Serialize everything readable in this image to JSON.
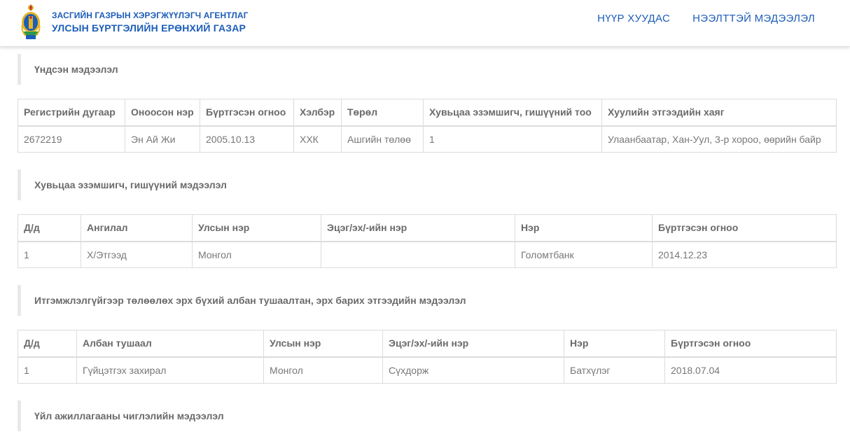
{
  "header": {
    "agency": "ЗАСГИЙН ГАЗРЫН ХЭРЭГЖҮҮЛЭГЧ АГЕНТЛАГ",
    "org": "УЛСЫН БҮРТГЭЛИЙН ЕРӨНХИЙ ГАЗАР",
    "nav": [
      "НҮҮР ХУУДАС",
      "НЭЭЛТТЭЙ МЭДЭЭЛЭЛ"
    ]
  },
  "basic": {
    "title": "Үндсэн мэдээлэл",
    "headers": [
      "Регистрийн дугаар",
      "Оноосон нэр",
      "Бүртгэсэн огноо",
      "Хэлбэр",
      "Төрөл",
      "Хувьцаа эзэмшигч, гишүүний тоо",
      "Хуулийн этгээдийн хаяг"
    ],
    "row": [
      "2672219",
      "Эн Ай Жи",
      "2005.10.13",
      "ХХК",
      "Ашгийн төлөө",
      "1",
      "Улаанбаатар, Хан-Уул, 3-р хороо, өөрийн байр"
    ]
  },
  "shareholders": {
    "title": "Хувьцаа эзэмшигч, гишүүний мэдээлэл",
    "headers": [
      "Д/д",
      "Ангилал",
      "Улсын нэр",
      "Эцэг/эх/-ийн нэр",
      "Нэр",
      "Бүртгэсэн огноо"
    ],
    "row": [
      "1",
      "Х/Этгээд",
      "Монгол",
      "",
      "Голомтбанк",
      "2014.12.23"
    ]
  },
  "officials": {
    "title": "Итгэмжлэлгүйгээр төлөөлөх эрх бүхий албан тушаалтан, эрх барих этгээдийн мэдээлэл",
    "headers": [
      "Д/д",
      "Албан тушаал",
      "Улсын нэр",
      "Эцэг/эх/-ийн нэр",
      "Нэр",
      "Бүртгэсэн огноо"
    ],
    "row": [
      "1",
      "Гүйцэтгэх захирал",
      "Монгол",
      "Сүхдорж",
      "Батхүлэг",
      "2018.07.04"
    ]
  },
  "activity": {
    "title": "Үйл ажиллагааны чиглэлийн мэдээлэл"
  },
  "colors": {
    "brand_blue": "#1d5db8",
    "emblem_gold": "#e6b422"
  },
  "icons": {
    "logo": "mongolia-state-emblem-icon"
  }
}
